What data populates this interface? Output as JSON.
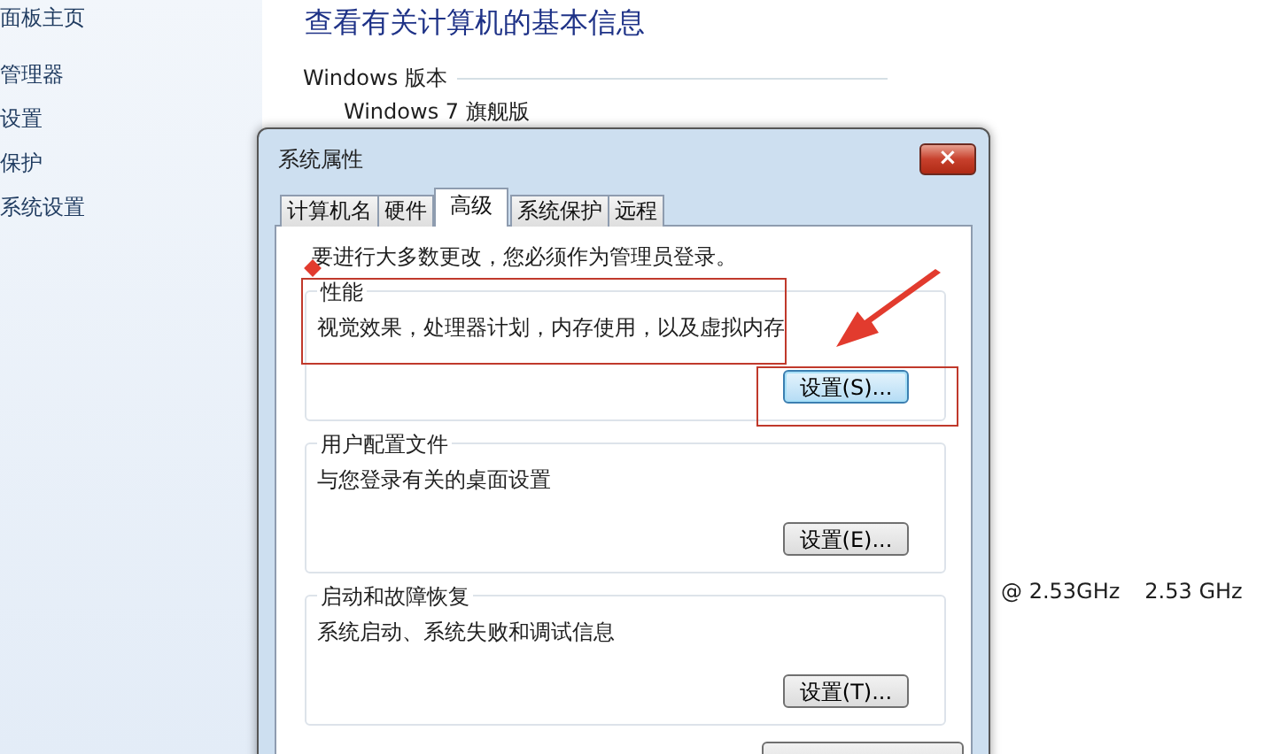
{
  "sidebar": {
    "items": [
      "面板主页",
      "管理器",
      "设置",
      "保护",
      "系统设置"
    ]
  },
  "main": {
    "title": "查看有关计算机的基本信息",
    "section_label": "Windows 版本",
    "edition": "Windows 7 旗舰版",
    "processor_speed": "@ 2.53GHz",
    "processor_speed_2": "2.53 GHz"
  },
  "dialog": {
    "title": "系统属性",
    "close": "×",
    "tabs": [
      {
        "label": "计算机名",
        "selected": false
      },
      {
        "label": "硬件",
        "selected": false
      },
      {
        "label": "高级",
        "selected": true
      },
      {
        "label": "系统保护",
        "selected": false
      },
      {
        "label": "远程",
        "selected": false
      }
    ],
    "notice": "要进行大多数更改，您必须作为管理员登录。",
    "groups": [
      {
        "title": "性能",
        "description": "视觉效果，处理器计划，内存使用，以及虚拟内存",
        "button": "设置(S)...",
        "highlighted": true
      },
      {
        "title": "用户配置文件",
        "description": "与您登录有关的桌面设置",
        "button": "设置(E)...",
        "highlighted": false
      },
      {
        "title": "启动和故障恢复",
        "description": "系统启动、系统失败和调试信息",
        "button": "设置(T)...",
        "highlighted": false
      }
    ]
  }
}
